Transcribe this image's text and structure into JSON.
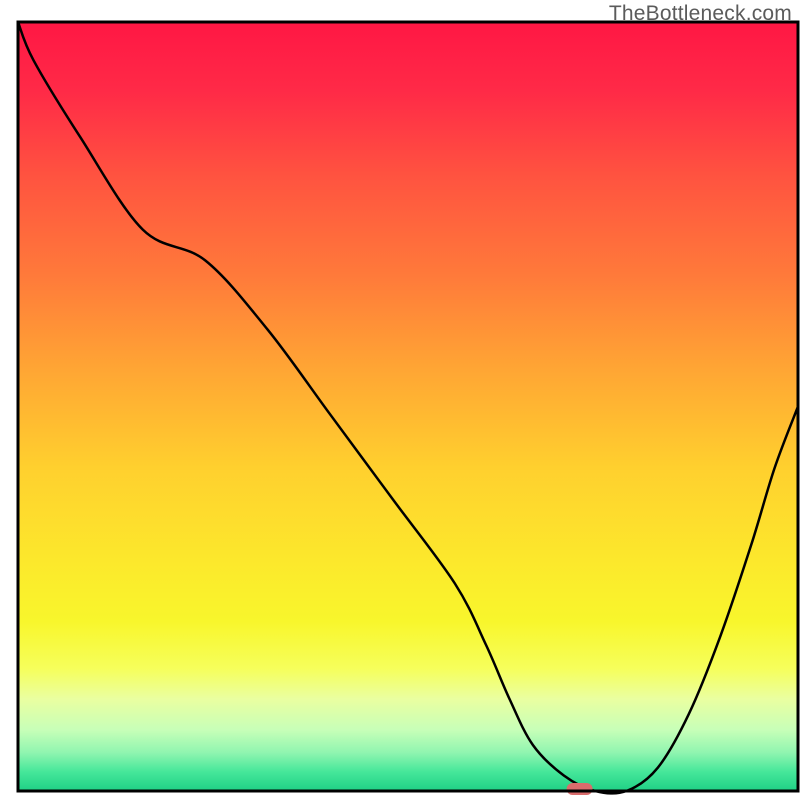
{
  "watermark": "TheBottleneck.com",
  "chart_data": {
    "type": "line",
    "title": "",
    "xlabel": "",
    "ylabel": "",
    "xlim": [
      0,
      100
    ],
    "ylim": [
      0,
      100
    ],
    "x": [
      0,
      2,
      8,
      16,
      24,
      32,
      40,
      48,
      56,
      60,
      63,
      66,
      70,
      74,
      78,
      82,
      86,
      90,
      94,
      97,
      100
    ],
    "values": [
      100,
      95,
      85,
      73,
      69,
      60,
      49,
      38,
      27,
      19,
      12,
      6,
      2,
      0,
      0,
      3,
      10,
      20,
      32,
      42,
      50
    ],
    "marker": {
      "x": 72,
      "y": 0,
      "color": "#d96c6c"
    },
    "gradient_stops": [
      {
        "offset": 0.0,
        "color": "#ff1744"
      },
      {
        "offset": 0.09,
        "color": "#ff2a47"
      },
      {
        "offset": 0.2,
        "color": "#ff5340"
      },
      {
        "offset": 0.33,
        "color": "#ff7a3a"
      },
      {
        "offset": 0.45,
        "color": "#ffa534"
      },
      {
        "offset": 0.58,
        "color": "#ffd02e"
      },
      {
        "offset": 0.7,
        "color": "#fce82c"
      },
      {
        "offset": 0.78,
        "color": "#f8f62c"
      },
      {
        "offset": 0.84,
        "color": "#f6ff5a"
      },
      {
        "offset": 0.88,
        "color": "#eaffa0"
      },
      {
        "offset": 0.92,
        "color": "#c8ffb8"
      },
      {
        "offset": 0.95,
        "color": "#90f5b0"
      },
      {
        "offset": 0.975,
        "color": "#46e79a"
      },
      {
        "offset": 1.0,
        "color": "#1fd085"
      }
    ]
  }
}
